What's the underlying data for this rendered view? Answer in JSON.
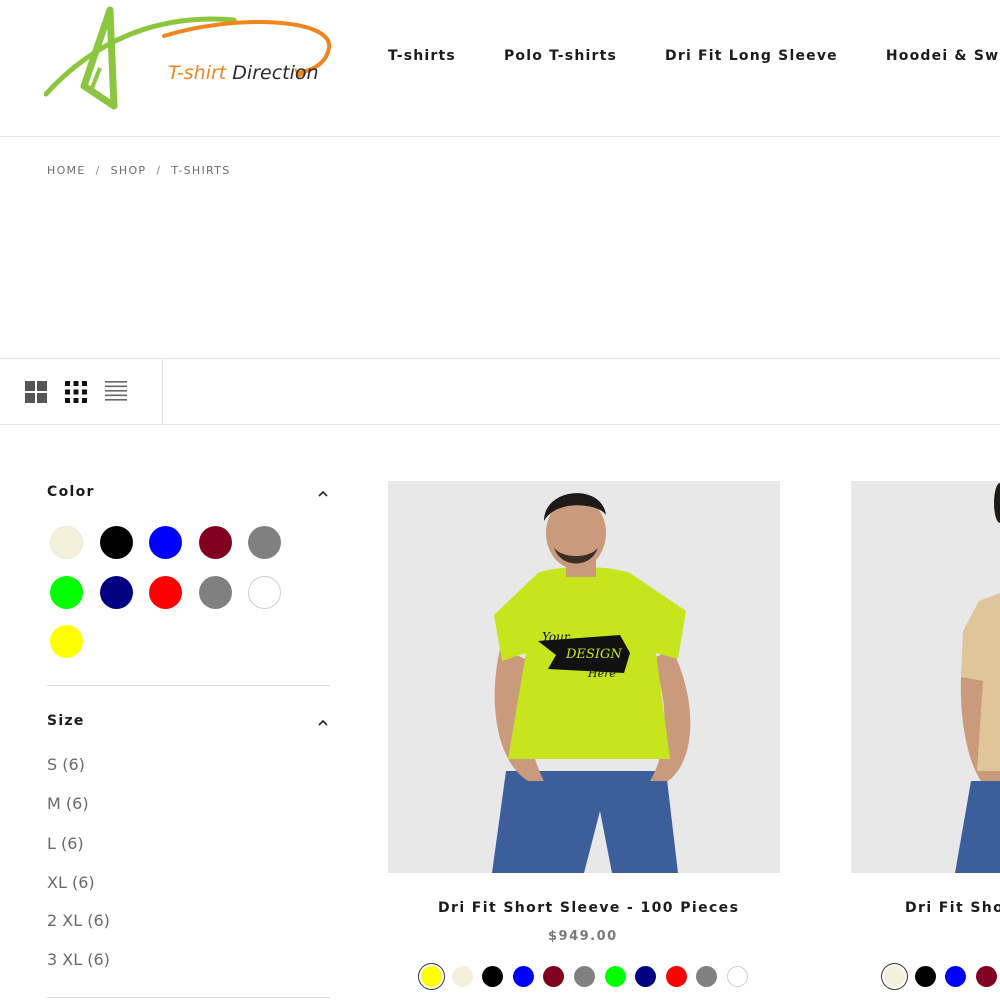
{
  "brand": {
    "logo_word1": "T-shirt",
    "logo_word2": "Direction",
    "colors": {
      "green": "#8cc63f",
      "orange": "#f0851d"
    }
  },
  "nav": {
    "items": [
      "T-shirts",
      "Polo T-shirts",
      "Dri Fit Long Sleeve",
      "Hoodei & Sw"
    ]
  },
  "breadcrumb": {
    "home": "HOME",
    "shop": "SHOP",
    "current": "T-SHIRTS",
    "separator": "/"
  },
  "toolbar": {
    "view_icons": [
      "grid-2-icon",
      "grid-3-icon",
      "list-icon"
    ]
  },
  "filters": {
    "color": {
      "title": "Color",
      "swatches": [
        "#f3f1dc",
        "#000000",
        "#0000ff",
        "#800020",
        "#808080",
        "#00ff00",
        "#000080",
        "#ff0000",
        "#808080",
        "#ffffff",
        "#ffff00"
      ]
    },
    "size": {
      "title": "Size",
      "options": [
        "S (6)",
        "M (6)",
        "L (6)",
        "XL (6)",
        "2 XL (6)",
        "3 XL (6)"
      ]
    }
  },
  "products": [
    {
      "title": "Dri Fit Short Sleeve - 100 Pieces",
      "price": "$949.00",
      "shirt_color": "#c6e51c",
      "print_line1": "Your",
      "print_line2": "DESIGN",
      "print_line3": "Here",
      "swatches": [
        "#ffff00",
        "#f3f1dc",
        "#000000",
        "#0000ff",
        "#800020",
        "#808080",
        "#00ff00",
        "#000080",
        "#ff0000",
        "#808080",
        "#ffffff"
      ]
    },
    {
      "title": "Dri Fit Sho",
      "shirt_color": "#e0c49a",
      "swatches": [
        "#f3f1dc",
        "#000000",
        "#0000ff",
        "#800020"
      ]
    }
  ]
}
